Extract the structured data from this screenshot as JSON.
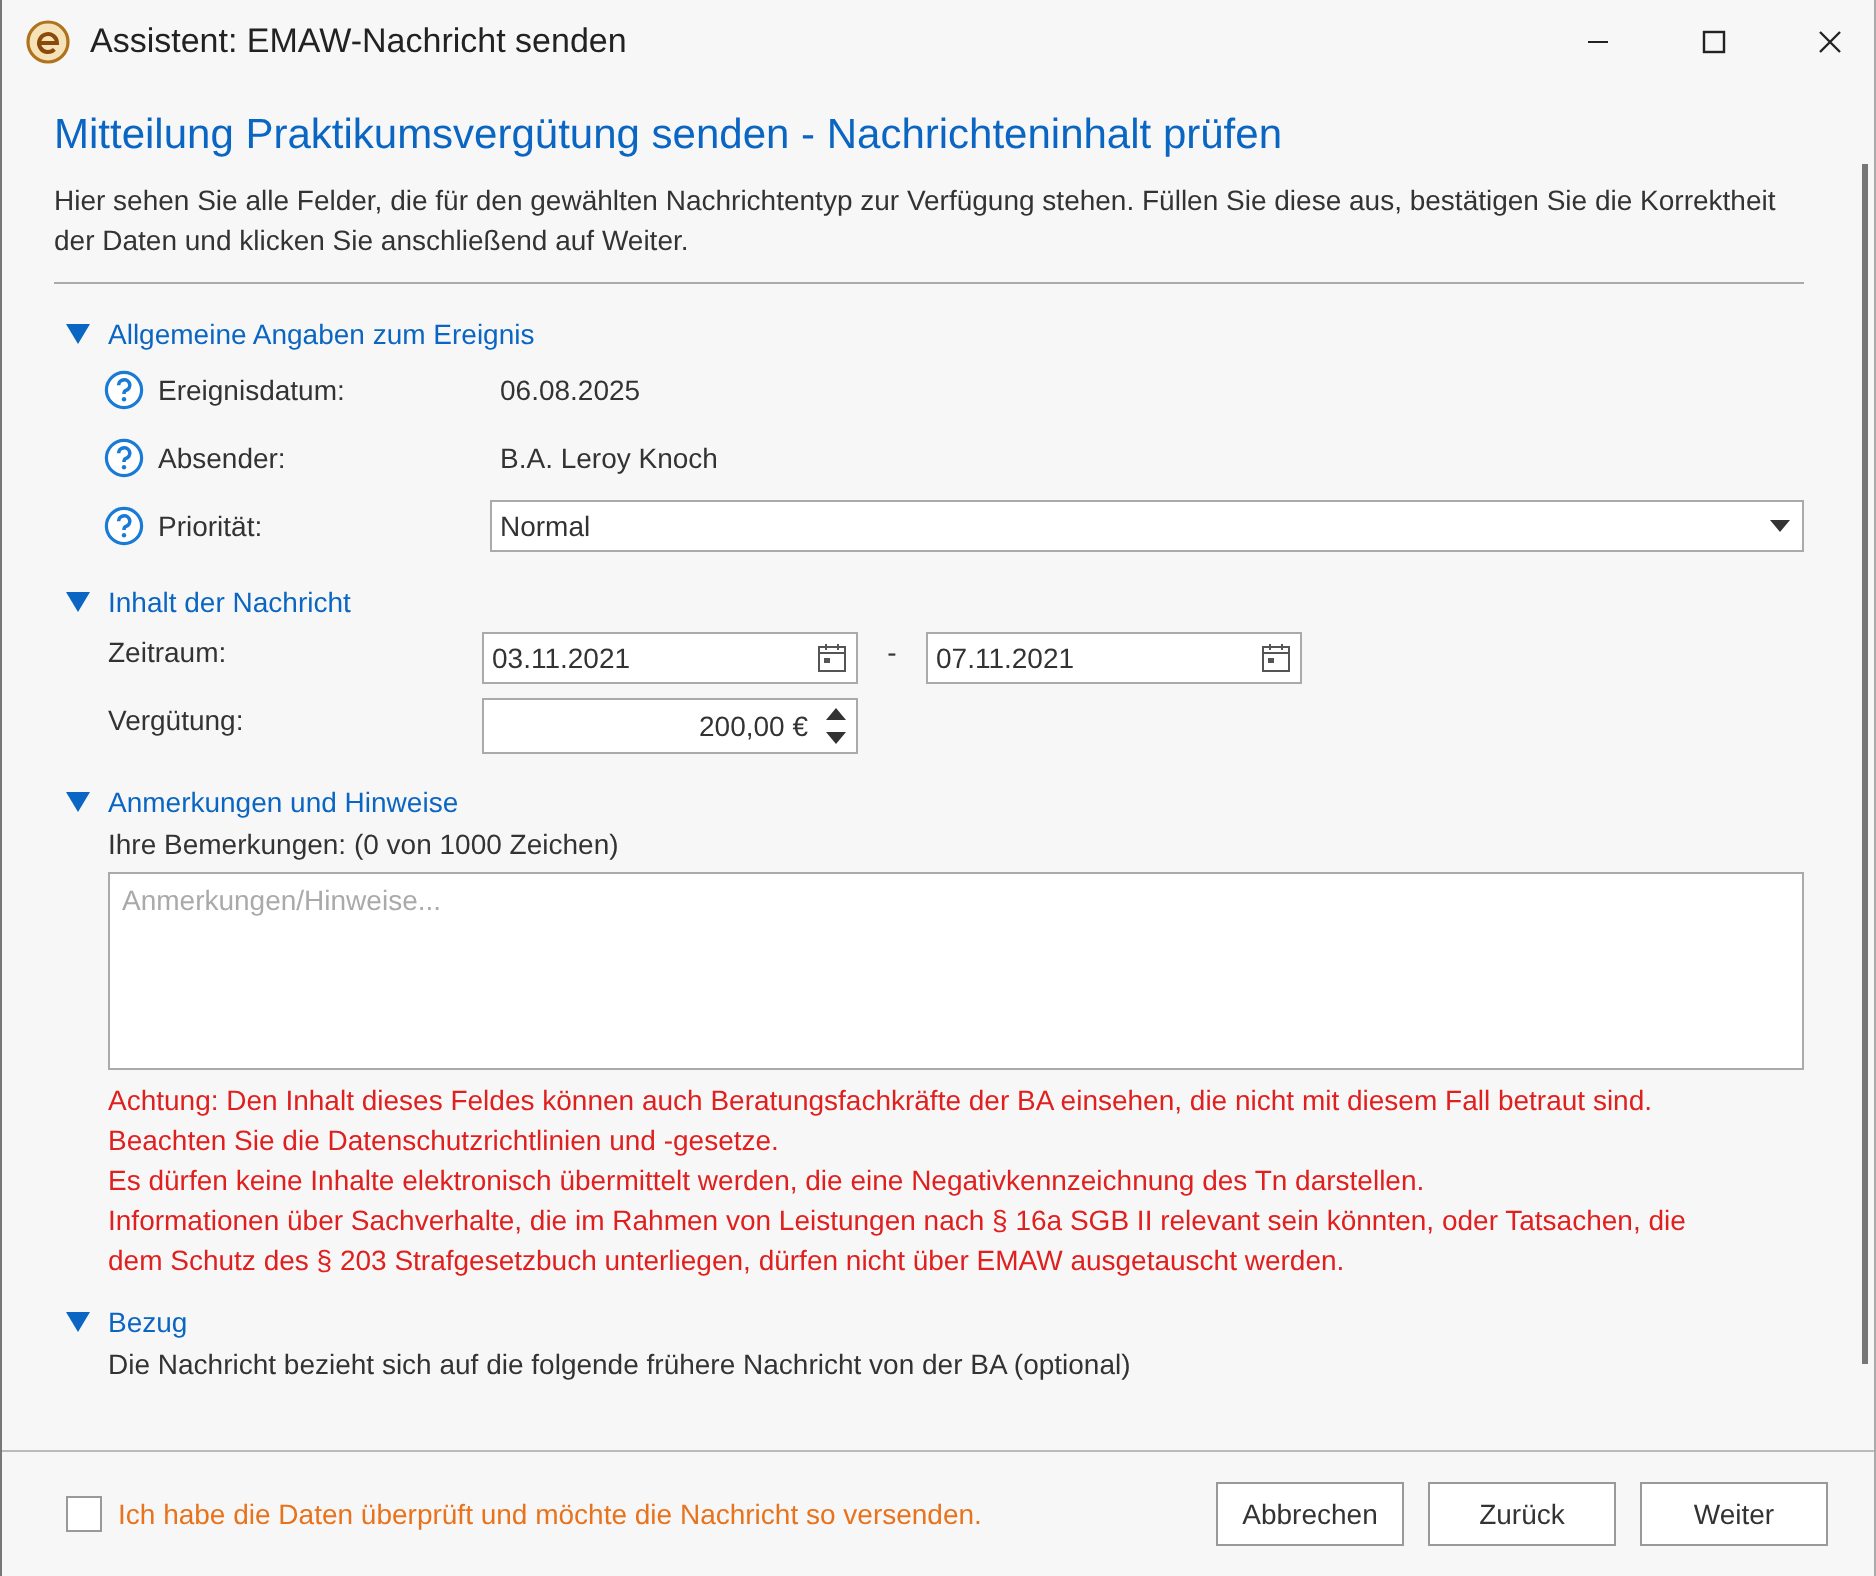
{
  "window": {
    "title": "Assistent: EMAW-Nachricht senden"
  },
  "heading": "Mitteilung Praktikumsvergütung senden - Nachrichteninhalt prüfen",
  "description": "Hier sehen Sie alle Felder, die für den gewählten Nachrichtentyp zur Verfügung stehen. Füllen Sie diese aus, bestätigen Sie die Korrektheit der Daten und klicken Sie anschließend auf Weiter.",
  "general": {
    "title": "Allgemeine Angaben zum Ereignis",
    "expanded": true,
    "rows": [
      {
        "kind": "text",
        "label": "Ereignisdatum:",
        "value": "06.08.2025"
      },
      {
        "kind": "text",
        "label": "Absender:",
        "value": "B.A. Leroy Knoch"
      },
      {
        "kind": "dropdown",
        "label": "Priorität:",
        "value": "Normal"
      }
    ]
  },
  "content": {
    "title": "Inhalt der Nachricht",
    "expanded": true,
    "period_label": "Zeitraum:",
    "date_from": "03.11.2021",
    "separator": "-",
    "date_to": "07.11.2021",
    "amount_label": "Vergütung:",
    "amount": "200,00 €"
  },
  "remarks": {
    "title": "Anmerkungen und Hinweise",
    "expanded": true,
    "label": "Ihre Bemerkungen: (0 von 1000 Zeichen)",
    "placeholder": "Anmerkungen/Hinweise...",
    "warnings": [
      "Achtung: Den Inhalt dieses Feldes können auch Beratungsfachkräfte der BA einsehen, die nicht mit diesem Fall betraut sind.",
      "Beachten Sie die Datenschutzrichtlinien und -gesetze.",
      "Es dürfen keine Inhalte elektronisch übermittelt werden, die eine Negativkennzeichnung des Tn darstellen.",
      "Informationen über Sachverhalte, die im Rahmen von Leistungen nach § 16a SGB II relevant sein könnten, oder Tatsachen, die dem Schutz des § 203 Strafgesetzbuch unterliegen, dürfen nicht über EMAW ausgetauscht werden."
    ]
  },
  "reference": {
    "title": "Bezug",
    "expanded": true,
    "text": "Die Nachricht bezieht sich auf die folgende frühere Nachricht von der BA (optional)"
  },
  "confirm": {
    "label": "Ich habe die Daten überprüft und möchte die Nachricht so versenden.",
    "checked": false
  },
  "buttons": [
    "Abbrechen",
    "Zurück",
    "Weiter"
  ]
}
